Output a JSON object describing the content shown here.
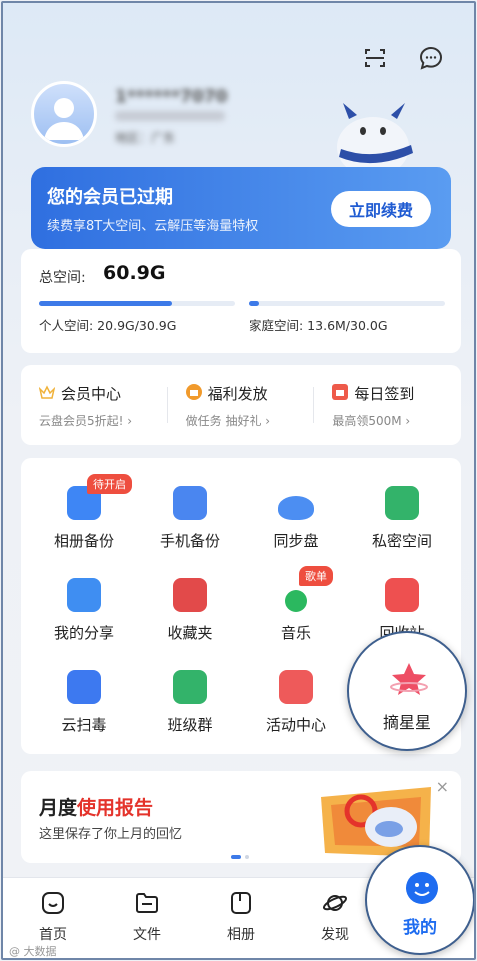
{
  "header": {
    "scan_icon": "scan-icon",
    "message_icon": "message-icon"
  },
  "profile": {
    "name": "1******7070",
    "subtitle": "地区：广东"
  },
  "vip": {
    "title": "您的会员已过期",
    "subtitle": "续费享8T大空间、云解压等海量特权",
    "renew_label": "立即续费"
  },
  "space": {
    "total_label": "总空间:",
    "total_value": "60.9G",
    "personal": "个人空间: 20.9G/30.9G",
    "personal_fraction": 0.68,
    "family": "家庭空间: 13.6M/30.0G",
    "family_fraction": 0.05
  },
  "quick": [
    {
      "title": "会员中心",
      "sub": "云盘会员5折起! ›",
      "icon": "crown-icon",
      "color": "#f0b23a"
    },
    {
      "title": "福利发放",
      "sub": "做任务 抽好礼 ›",
      "icon": "gift-badge-icon",
      "color": "#f19a2c"
    },
    {
      "title": "每日签到",
      "sub": "最高领500M ›",
      "icon": "calendar-icon",
      "color": "#ee5a4a"
    }
  ],
  "grid": [
    {
      "label": "相册备份",
      "badge": "待开启",
      "color": "#3e86f5"
    },
    {
      "label": "手机备份",
      "badge": "",
      "color": "#4a86f0"
    },
    {
      "label": "同步盘",
      "badge": "",
      "color": "#4c8ef2"
    },
    {
      "label": "私密空间",
      "badge": "",
      "color": "#33b36a"
    },
    {
      "label": "我的分享",
      "badge": "",
      "color": "#3f8ef2"
    },
    {
      "label": "收藏夹",
      "badge": "",
      "color": "#e24a4a"
    },
    {
      "label": "音乐",
      "badge": "歌单",
      "color": "#2bb85f"
    },
    {
      "label": "回收站",
      "badge": "",
      "color": "#ee5050"
    },
    {
      "label": "云扫毒",
      "badge": "",
      "color": "#3d79f0"
    },
    {
      "label": "班级群",
      "badge": "",
      "color": "#33b36a"
    },
    {
      "label": "活动中心",
      "badge": "",
      "color": "#ee5a5a"
    }
  ],
  "report": {
    "title_a": "月度",
    "title_b": "使用报告",
    "subtitle": "这里保存了你上月的回忆",
    "close": "×"
  },
  "magnifier_star": {
    "label": "摘星星"
  },
  "tabs": [
    {
      "label": "首页"
    },
    {
      "label": "文件"
    },
    {
      "label": "相册"
    },
    {
      "label": "发现"
    },
    {
      "label": "我的"
    }
  ],
  "watermark": "@ 大数据"
}
